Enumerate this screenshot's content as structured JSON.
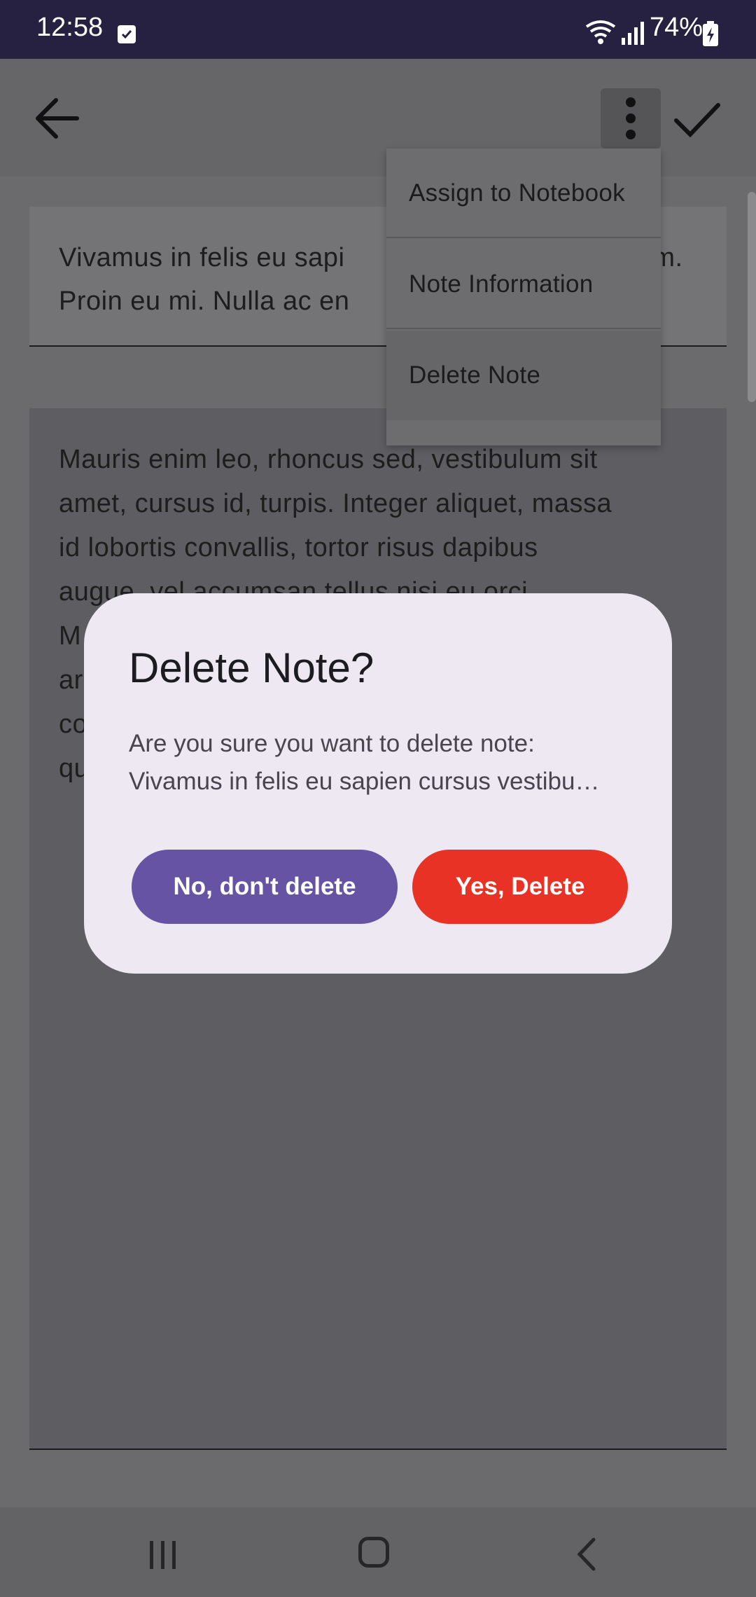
{
  "status_bar": {
    "time": "12:58",
    "battery": "74%"
  },
  "app_bar": {
    "back_icon": "arrow-left-icon",
    "more_icon": "more-vert-icon",
    "save_icon": "check-icon"
  },
  "note": {
    "title_visible": "Vivamus in felis eu sapi                                m. Proin eu mi. Nulla ac en",
    "title_line1_left": "Vivamus in felis eu sapi",
    "title_line1_right": "m.",
    "title_line2": "Proin eu mi. Nulla ac en",
    "body_lines": [
      "Mauris enim leo, rhoncus sed, vestibulum sit",
      "amet, cursus id, turpis. Integer aliquet, massa",
      "id lobortis convallis, tortor risus dapibus",
      "augue, vel accumsan tellus nisi eu orci.",
      "M",
      "ar",
      "co",
      "qu"
    ]
  },
  "menu": {
    "items": [
      "Assign to Notebook",
      "Note Information",
      "Delete Note"
    ]
  },
  "dialog": {
    "title": "Delete Note?",
    "message_line1": "Are you sure you want to delete note:",
    "message_line2": "Vivamus in felis eu sapien cursus vestibu…",
    "cancel_label": "No, don't delete",
    "confirm_label": "Yes, Delete",
    "cancel_color": "#6653a3",
    "confirm_color": "#e83226"
  },
  "nav_bar": {
    "recent_icon": "recent-apps-icon",
    "home_icon": "home-icon",
    "back_icon": "back-icon"
  }
}
